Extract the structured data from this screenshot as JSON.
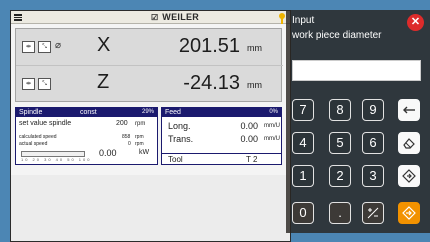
{
  "brand": {
    "mark": "☑",
    "name": "WEILER"
  },
  "axes": [
    {
      "name": "X",
      "diameter_symbol": "⌀",
      "value": "201.51",
      "unit": "mm",
      "icon1": "⇹",
      "icon2": "⤡"
    },
    {
      "name": "Z",
      "value": "-24.13",
      "unit": "mm",
      "icon1": "⇹",
      "icon2": "⤡"
    }
  ],
  "spindle": {
    "title": "Spindle",
    "mode": "const",
    "percent": "29%",
    "set_value_label": "set value spindle",
    "set_value": "200",
    "set_unit": "rpm",
    "calc_label": "calculated speed",
    "calc_value": "858",
    "calc_unit": "rpm",
    "actual_label": "actual speed",
    "actual_value": "0",
    "actual_unit": "rpm",
    "scale_label": "10 20 30 40 50 100",
    "power_value": "0.00",
    "power_unit": "kW"
  },
  "feed": {
    "title": "Feed",
    "percent": "0%",
    "long_label": "Long.",
    "long_value": "0.00",
    "long_unit": "mm/U",
    "trans_label": "Trans.",
    "trans_value": "0.00",
    "trans_unit": "mm/U",
    "tool_label": "Tool",
    "tool_value": "T 2"
  },
  "dialog": {
    "title_line1": "Input",
    "title_line2": "work piece diameter",
    "close": "✕",
    "input_value": "",
    "keys": {
      "k7": "7",
      "k8": "8",
      "k9": "9",
      "k4": "4",
      "k5": "5",
      "k6": "6",
      "k1": "1",
      "k2": "2",
      "k3": "3",
      "k0": "0",
      "dot": "."
    }
  },
  "colors": {
    "background": "#4c86b4",
    "panel_header": "#1b1a6e",
    "close_button": "#dd2b2b",
    "enter_key": "#f29200",
    "status": "#f0b400"
  }
}
